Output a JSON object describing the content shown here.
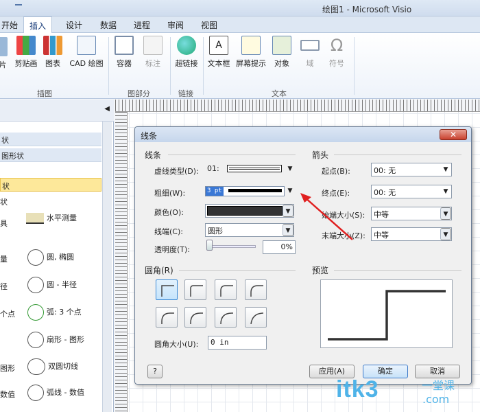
{
  "window": {
    "title": "绘图1 - Microsoft Visio"
  },
  "tabs": [
    "开始",
    "插入",
    "设计",
    "数据",
    "进程",
    "审阅",
    "视图"
  ],
  "ribbon": {
    "buttons": [
      "片",
      "剪贴画",
      "图表",
      "CAD 绘图",
      "容器",
      "标注",
      "超链接",
      "文本框",
      "屏幕提示",
      "对象",
      "域",
      "符号"
    ],
    "groups": [
      "插图",
      "图部分",
      "链接",
      "文本"
    ]
  },
  "left_pane": {
    "rows": [
      "状",
      "图形状",
      "状"
    ],
    "shapes": [
      "具",
      "水平测量",
      "量",
      "圆, 椭圆",
      "径",
      "圆 - 半径",
      "个点",
      "弧: 3 个点",
      "扇形 - 图形",
      "图形",
      "双圆切线",
      "数值",
      "弧线 - 数值"
    ],
    "section": "状"
  },
  "dialog": {
    "title": "线条",
    "close": "✕",
    "line_section": "线条",
    "dash_label": "虚线类型(D):",
    "dash_value": "01:",
    "weight_label": "粗细(W):",
    "weight_value": "3 pt",
    "color_label": "颜色(O):",
    "cap_label": "线端(C):",
    "cap_value": "圆形",
    "trans_label": "透明度(T):",
    "trans_value": "0%",
    "arrow_section": "箭头",
    "begin_label": "起点(B):",
    "begin_value": "00: 无",
    "end_label": "终点(E):",
    "end_value": "00: 无",
    "begin_size_label": "始端大小(S):",
    "begin_size_value": "中等",
    "end_size_label": "末端大小(Z):",
    "end_size_value": "中等",
    "round_section": "圆角(R)",
    "round_size_label": "圆角大小(U):",
    "round_size_value": "0 in",
    "preview_section": "预览",
    "help": "?",
    "apply": "应用(A)",
    "ok": "确定",
    "cancel": "取消"
  },
  "watermark": {
    "text": "itk3",
    "suffix": ".com",
    "sub": "一堂课"
  }
}
